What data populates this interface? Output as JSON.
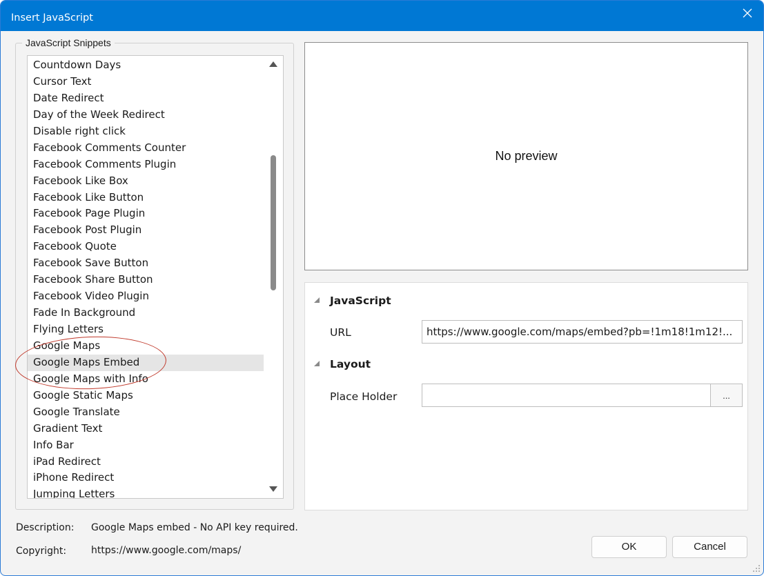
{
  "window": {
    "title": "Insert JavaScript"
  },
  "snippets": {
    "group_label": "JavaScript Snippets",
    "items": [
      "Countdown Days",
      "Cursor Text",
      "Date Redirect",
      "Day of the Week Redirect",
      "Disable right click",
      "Facebook Comments Counter",
      "Facebook Comments Plugin",
      "Facebook Like Box",
      "Facebook Like Button",
      "Facebook Page Plugin",
      "Facebook Post Plugin",
      "Facebook Quote",
      "Facebook Save Button",
      "Facebook Share Button",
      "Facebook Video Plugin",
      "Fade In Background",
      "Flying Letters",
      "Google Maps",
      "Google Maps Embed",
      "Google Maps with Info",
      "Google Static Maps",
      "Google Translate",
      "Gradient Text",
      "Info Bar",
      "iPad Redirect",
      "iPhone Redirect",
      "Jumping Letters"
    ],
    "selected": "Google Maps Embed"
  },
  "preview": {
    "text": "No preview"
  },
  "properties": {
    "javascript": {
      "label": "JavaScript",
      "url_label": "URL",
      "url_value": "https://www.google.com/maps/embed?pb=!1m18!1m12!..."
    },
    "layout": {
      "label": "Layout",
      "placeholder_label": "Place Holder",
      "placeholder_value": "",
      "browse_label": "..."
    }
  },
  "info": {
    "description_label": "Description:",
    "description_value": "Google Maps embed - No API key required.",
    "copyright_label": "Copyright:",
    "copyright_value": "https://www.google.com/maps/"
  },
  "buttons": {
    "ok": "OK",
    "cancel": "Cancel"
  },
  "colors": {
    "titlebar": "#0078d4",
    "selection": "#e5e5e5",
    "annotation": "#c0392b"
  }
}
